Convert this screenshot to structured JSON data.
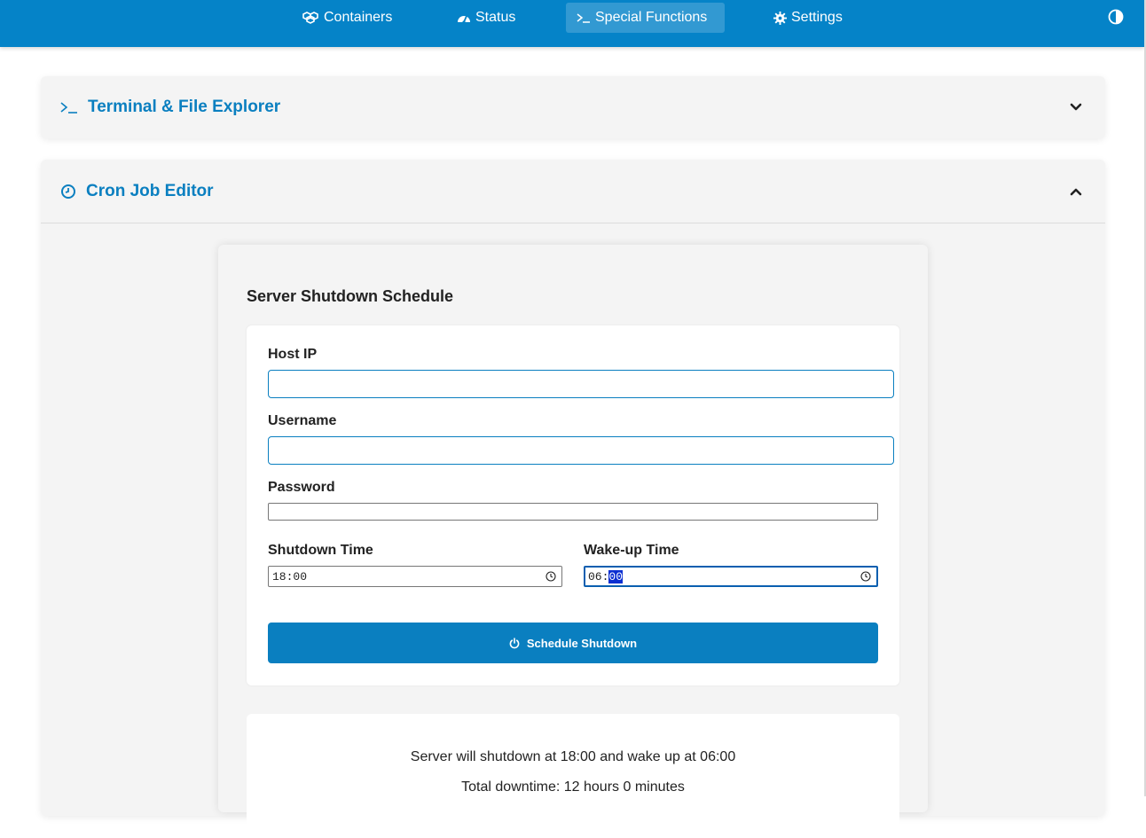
{
  "nav": {
    "items": [
      {
        "label": "Containers",
        "icon": "cubes-icon"
      },
      {
        "label": "Status",
        "icon": "gauge-icon"
      },
      {
        "label": "Special Functions",
        "icon": "terminal-icon",
        "active": true
      },
      {
        "label": "Settings",
        "icon": "gear-icon"
      }
    ],
    "theme_toggle_icon": "contrast-icon"
  },
  "panels": {
    "terminal": {
      "title": "Terminal & File Explorer",
      "icon": "terminal-icon",
      "expanded": false
    },
    "cron": {
      "title": "Cron Job Editor",
      "icon": "clock-icon",
      "expanded": true
    }
  },
  "shutdown_form": {
    "title": "Server Shutdown Schedule",
    "host_ip": {
      "label": "Host IP",
      "value": ""
    },
    "username": {
      "label": "Username",
      "value": ""
    },
    "password": {
      "label": "Password",
      "value": ""
    },
    "shutdown_time": {
      "label": "Shutdown Time",
      "hours": "18",
      "minutes": "00"
    },
    "wakeup_time": {
      "label": "Wake-up Time",
      "hours": "06",
      "minutes": "00"
    },
    "submit_label": "Schedule Shutdown",
    "submit_icon": "power-icon"
  },
  "summary": {
    "line1": "Server will shutdown at 18:00 and wake up at 06:00",
    "line2": "Total downtime: 12 hours 0 minutes"
  },
  "colors": {
    "primary": "#0583c8",
    "accent_text": "#0a7fc0",
    "panel_bg": "#f4f4f4",
    "selection": "#0b2fd1"
  }
}
